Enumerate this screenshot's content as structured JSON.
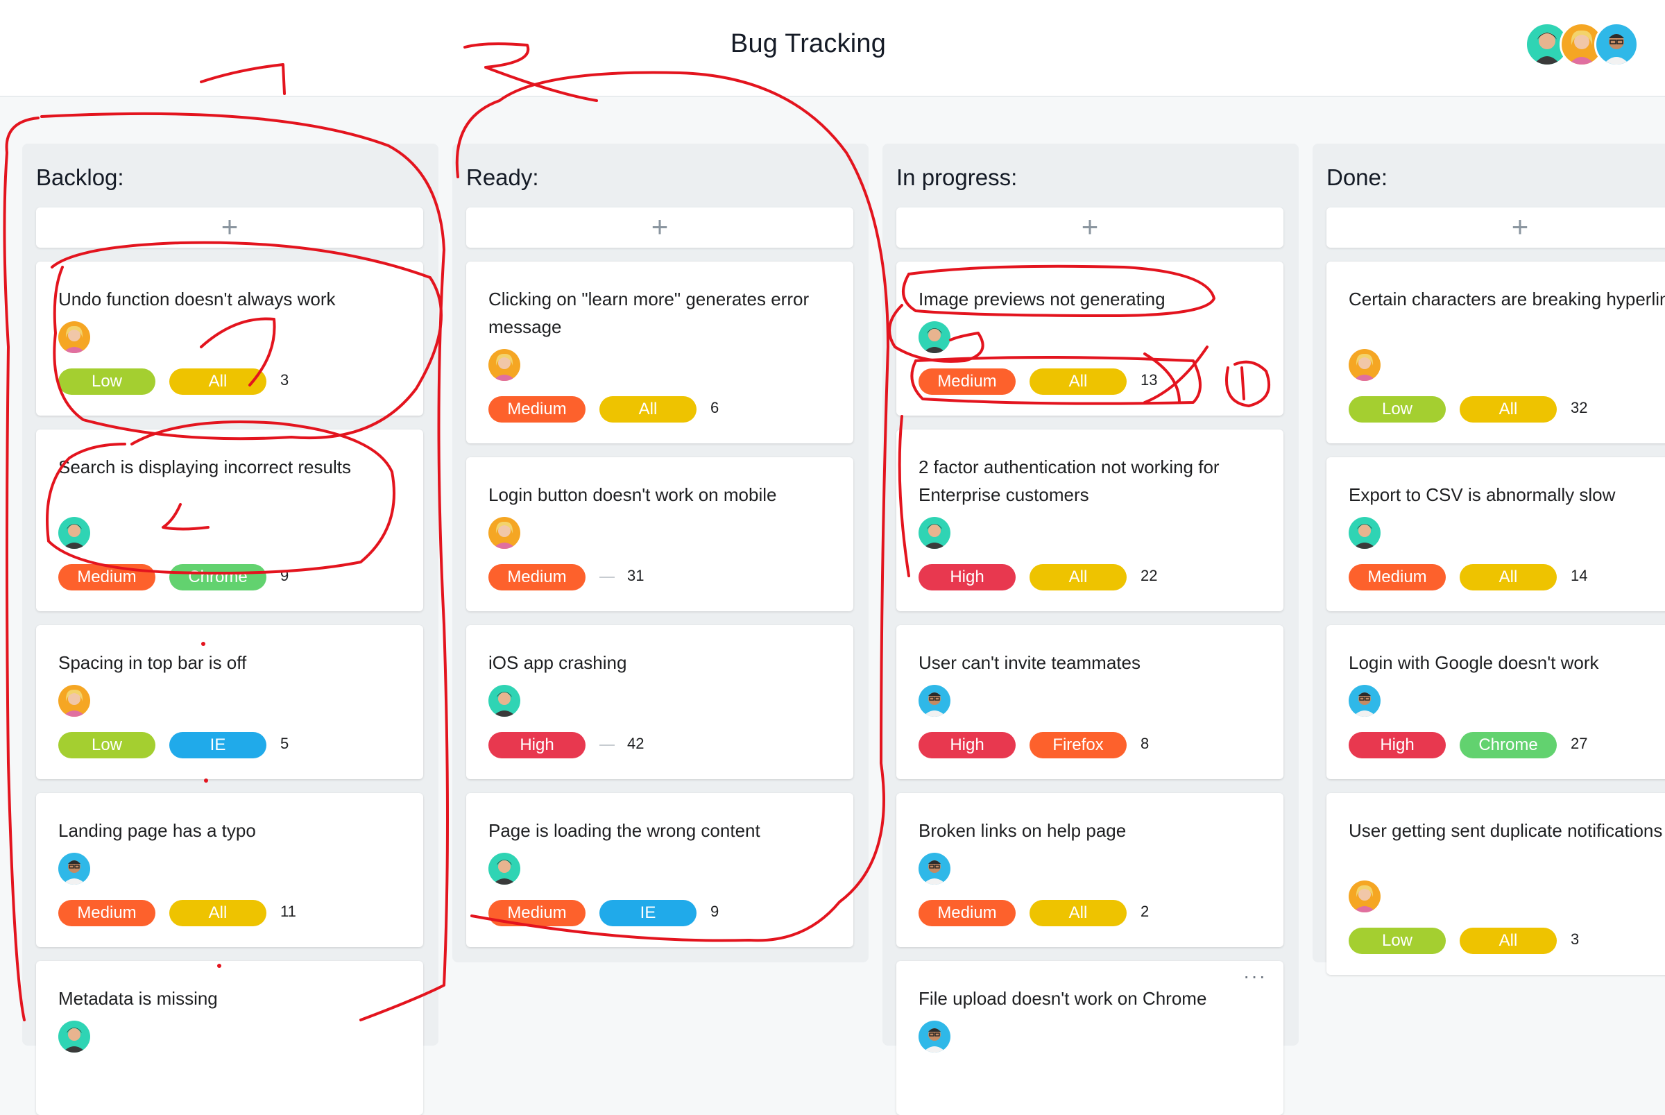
{
  "app": {
    "title": "Bug Tracking",
    "avatars": [
      "member-1",
      "member-2",
      "member-3"
    ]
  },
  "board": {
    "add_label": "+",
    "columns": [
      {
        "title": "Backlog:",
        "cards": [
          {
            "title": "Undo function doesn't always work",
            "assignee": "blonde",
            "priority": "Low",
            "browser": "All",
            "count": "3"
          },
          {
            "title": "Search is displaying incorrect results",
            "assignee": "darkhair",
            "priority": "Medium",
            "browser": "Chrome",
            "count": "9"
          },
          {
            "title": "Spacing in top bar is off",
            "assignee": "blonde",
            "priority": "Low",
            "browser": "IE",
            "count": "5"
          },
          {
            "title": "Landing page has a typo",
            "assignee": "glasses",
            "priority": "Medium",
            "browser": "All",
            "count": "11"
          },
          {
            "title": "Metadata is missing",
            "assignee": "darkhair",
            "priority": "",
            "browser": "",
            "count": ""
          }
        ]
      },
      {
        "title": "Ready:",
        "cards": [
          {
            "title": "Clicking on \"learn more\" generates error message",
            "assignee": "blonde",
            "priority": "Medium",
            "browser": "All",
            "count": "6"
          },
          {
            "title": "Login button doesn't work on mobile",
            "assignee": "blonde",
            "priority": "Medium",
            "browser": "",
            "count": "31"
          },
          {
            "title": "iOS app crashing",
            "assignee": "darkhair",
            "priority": "High",
            "browser": "",
            "count": "42"
          },
          {
            "title": "Page is loading the wrong content",
            "assignee": "darkhair",
            "priority": "Medium",
            "browser": "IE",
            "count": "9"
          }
        ]
      },
      {
        "title": "In progress:",
        "cards": [
          {
            "title": "Image previews not generating",
            "assignee": "darkhair",
            "priority": "Medium",
            "browser": "All",
            "count": "13"
          },
          {
            "title": "2 factor authentication not working for Enterprise customers",
            "assignee": "darkhair",
            "priority": "High",
            "browser": "All",
            "count": "22"
          },
          {
            "title": "User can't invite teammates",
            "assignee": "glasses",
            "priority": "High",
            "browser": "Firefox",
            "count": "8"
          },
          {
            "title": "Broken links on help page",
            "assignee": "glasses",
            "priority": "Medium",
            "browser": "All",
            "count": "2"
          },
          {
            "title": "File upload doesn't work on Chrome",
            "assignee": "glasses",
            "priority": "",
            "browser": "",
            "count": "",
            "more": "···"
          }
        ]
      },
      {
        "title": "Done:",
        "cards": [
          {
            "title": "Certain characters are breaking hyperlinks",
            "assignee": "blonde",
            "priority": "Low",
            "browser": "All",
            "count": "32"
          },
          {
            "title": "Export to CSV is abnormally slow",
            "assignee": "darkhair",
            "priority": "Medium",
            "browser": "All",
            "count": "14"
          },
          {
            "title": "Login with Google doesn't work",
            "assignee": "glasses",
            "priority": "High",
            "browser": "Chrome",
            "count": "27"
          },
          {
            "title": "User getting sent duplicate notifications",
            "assignee": "blonde",
            "priority": "Low",
            "browser": "All",
            "count": "3"
          }
        ]
      }
    ]
  },
  "colors": {
    "Low": "#a4cf30",
    "Medium": "#fd612c",
    "High": "#e8384f",
    "All": "#eec300",
    "IE": "#20aaea",
    "Chrome": "#62d26f",
    "Firefox": "#fd612c",
    "annotation": "#e3141e"
  },
  "annotation_text": "D"
}
